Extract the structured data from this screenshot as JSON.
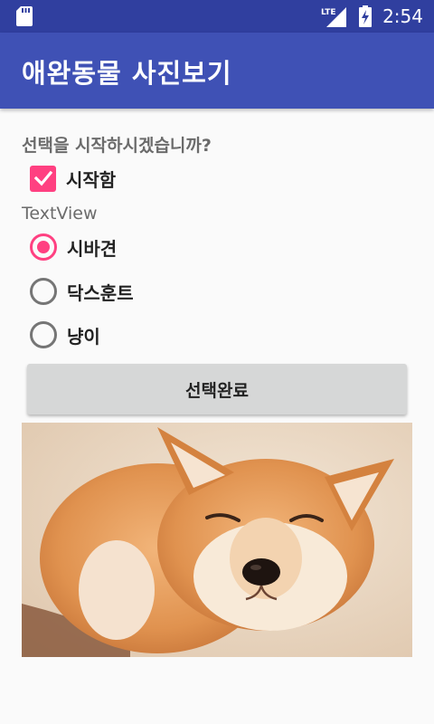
{
  "status_bar": {
    "time": "2:54",
    "network": "LTE",
    "icons": [
      "sd-card-icon",
      "lte-signal-icon",
      "battery-charging-icon"
    ]
  },
  "app_bar": {
    "title": "애완동물 사진보기"
  },
  "prompt": {
    "question": "선택을 시작하시겠습니까?"
  },
  "start_checkbox": {
    "label": "시작함",
    "checked": true
  },
  "textview": {
    "text": "TextView"
  },
  "radio_group": {
    "options": [
      {
        "label": "시바견",
        "checked": true
      },
      {
        "label": "닥스훈트",
        "checked": false
      },
      {
        "label": "냥이",
        "checked": false
      }
    ]
  },
  "done_button": {
    "label": "선택완료"
  },
  "photo": {
    "subject": "shiba-inu-dog"
  },
  "colors": {
    "primary": "#3f51b5",
    "primary_dark": "#303f9f",
    "accent": "#ff4081",
    "button": "#d6d7d7"
  }
}
